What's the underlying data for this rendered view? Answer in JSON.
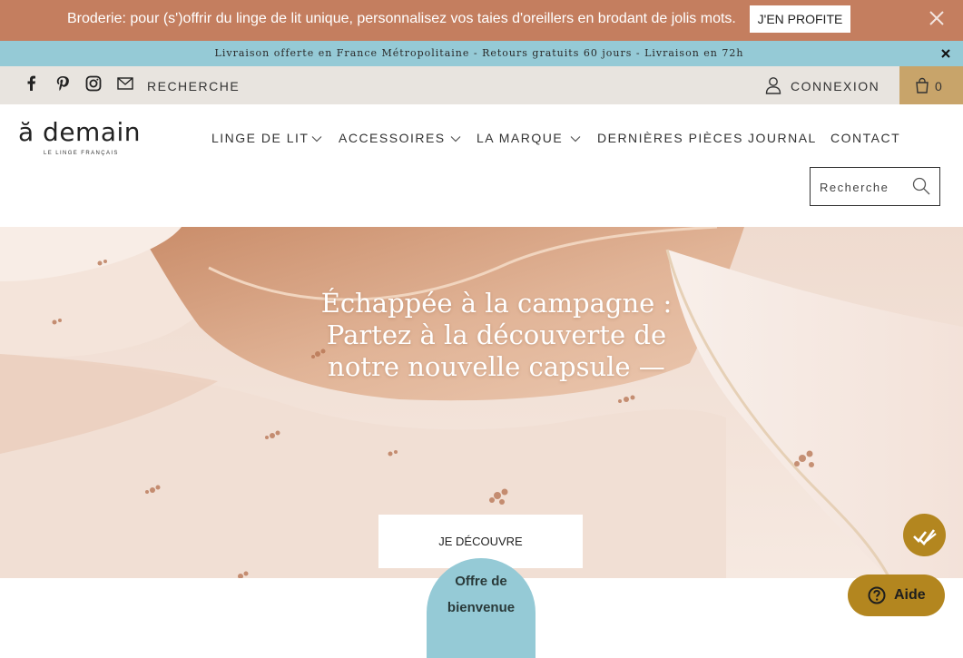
{
  "promo": {
    "text": "Broderie: pour (s')offrir du linge de lit unique, personnalisez vos taies d'oreillers en brodant de jolis mots.",
    "button_label": "J'EN PROFITE"
  },
  "info_bar": {
    "text": "Livraison offerte en France Métropolitaine - Retours gratuits 60 jours - Livraison en 72h"
  },
  "utility": {
    "social_icons": [
      "facebook-icon",
      "pinterest-icon",
      "instagram-icon",
      "mail-icon"
    ],
    "search_label": "RECHERCHE",
    "login_label": "CONNEXION",
    "cart_count": "0"
  },
  "header": {
    "logo_main": "ă demain",
    "logo_sub": "LE LINGE FRANÇAIS",
    "nav": [
      {
        "label": "LINGE DE LIT",
        "has_dropdown": true
      },
      {
        "label": "ACCESSOIRES",
        "has_dropdown": true
      },
      {
        "label": "LA MARQUE",
        "has_dropdown": true
      },
      {
        "label": "DERNIÈRES PIÈCES",
        "has_dropdown": false
      },
      {
        "label": "JOURNAL",
        "has_dropdown": false
      },
      {
        "label": "CONTACT",
        "has_dropdown": false
      }
    ],
    "search_placeholder": "Recherche"
  },
  "hero": {
    "title_lines": [
      "Échappée à la campagne :",
      "Partez à la découverte de",
      "notre nouvelle capsule —"
    ],
    "button_label": "JE DÉCOUVRE"
  },
  "offer": {
    "lines": [
      "Offre de",
      "bienvenue"
    ]
  },
  "help": {
    "label": "Aide"
  },
  "colors": {
    "promo_bg": "#c47e5f",
    "info_bg": "#95cad6",
    "utility_bg": "#e8e4df",
    "cart_bg": "#c8a46a",
    "accent_gold": "#b3861f"
  }
}
